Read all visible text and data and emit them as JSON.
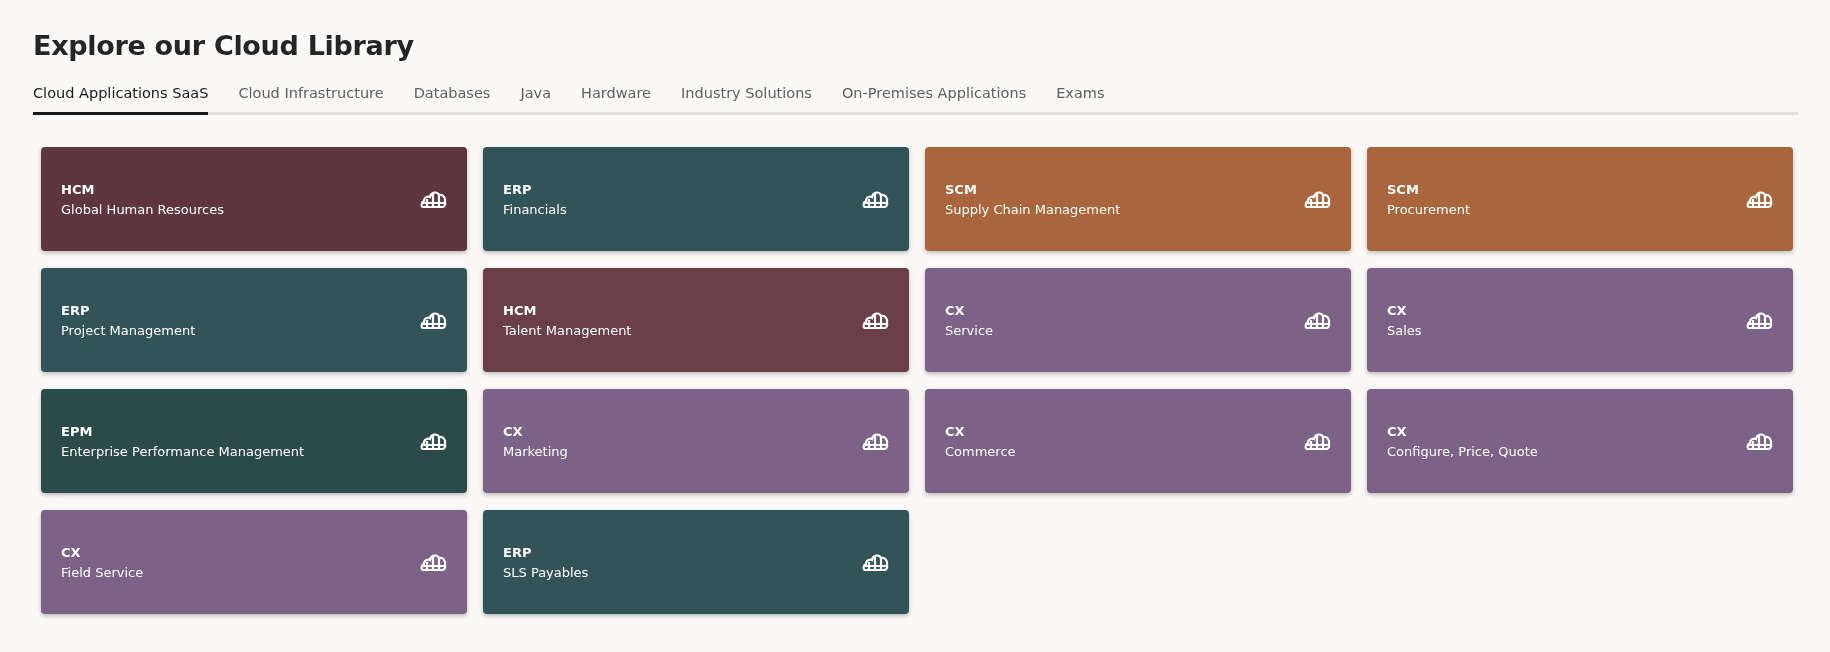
{
  "title": "Explore our Cloud Library",
  "tabs": [
    {
      "label": "Cloud Applications SaaS",
      "selected": true
    },
    {
      "label": "Cloud Infrastructure",
      "selected": false
    },
    {
      "label": "Databases",
      "selected": false
    },
    {
      "label": "Java",
      "selected": false
    },
    {
      "label": "Hardware",
      "selected": false
    },
    {
      "label": "Industry Solutions",
      "selected": false
    },
    {
      "label": "On-Premises Applications",
      "selected": false
    },
    {
      "label": "Exams",
      "selected": false
    }
  ],
  "cards": [
    {
      "category": "HCM",
      "name": "Global Human Resources",
      "color": "#5f3540"
    },
    {
      "category": "ERP",
      "name": "Financials",
      "color": "#325458"
    },
    {
      "category": "SCM",
      "name": "Supply Chain Management",
      "color": "#a9653b"
    },
    {
      "category": "SCM",
      "name": "Procurement",
      "color": "#a9653b"
    },
    {
      "category": "ERP",
      "name": "Project Management",
      "color": "#325458"
    },
    {
      "category": "HCM",
      "name": "Talent Management",
      "color": "#6a3f48"
    },
    {
      "category": "CX",
      "name": "Service",
      "color": "#7b6286"
    },
    {
      "category": "CX",
      "name": "Sales",
      "color": "#7b6286"
    },
    {
      "category": "EPM",
      "name": "Enterprise Performance Management",
      "color": "#2c4a4a"
    },
    {
      "category": "CX",
      "name": "Marketing",
      "color": "#7b6286"
    },
    {
      "category": "CX",
      "name": "Commerce",
      "color": "#7b6286"
    },
    {
      "category": "CX",
      "name": "Configure, Price, Quote",
      "color": "#7b6286"
    },
    {
      "category": "CX",
      "name": "Field Service",
      "color": "#7b6286"
    },
    {
      "category": "ERP",
      "name": "SLS Payables",
      "color": "#325458"
    }
  ]
}
